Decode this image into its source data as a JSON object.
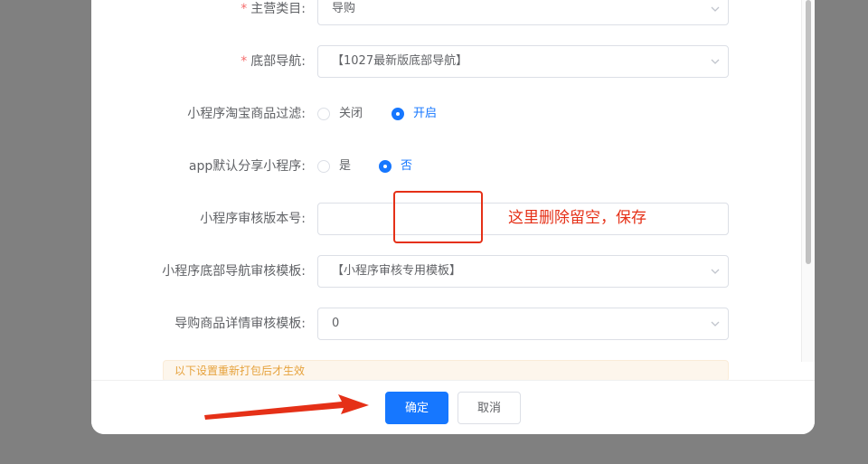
{
  "form": {
    "main_category": {
      "label": "主营类目:",
      "value": "导购"
    },
    "bottom_nav": {
      "label": "底部导航:",
      "value": "【1027最新版底部导航】"
    },
    "taobao_filter": {
      "label": "小程序淘宝商品过滤:",
      "options": [
        "关闭",
        "开启"
      ],
      "selected": 1
    },
    "app_share": {
      "label": "app默认分享小程序:",
      "options": [
        "是",
        "否"
      ],
      "selected": 1
    },
    "review_version": {
      "label": "小程序审核版本号:",
      "value": ""
    },
    "review_nav_template": {
      "label": "小程序底部导航审核模板:",
      "value": "【小程序审核专用模板】"
    },
    "review_detail_template": {
      "label": "导购商品详情审核模板:",
      "value": "0"
    },
    "notice": "以下设置重新打包后才生效"
  },
  "footer": {
    "confirm_label": "确定",
    "cancel_label": "取消"
  },
  "annotation": {
    "text": "这里删除留空，保存"
  },
  "colors": {
    "primary": "#1677ff",
    "annotation": "#e53017",
    "required": "#f56c6c"
  }
}
